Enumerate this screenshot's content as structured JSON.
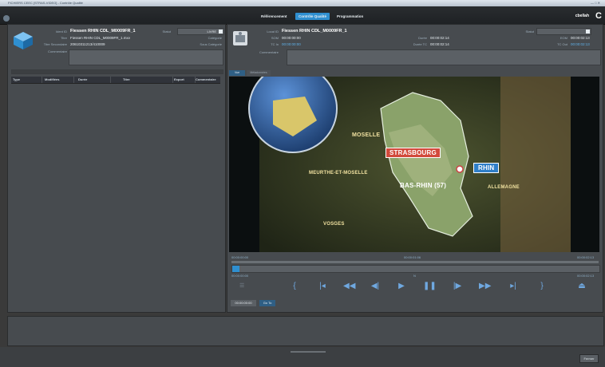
{
  "window": {
    "title": "FICHIERS CEEC [STRAS-VIDEO] - Contrôle Qualité",
    "controls": "— □ ✕"
  },
  "nav": {
    "tabs": [
      {
        "label": "Référencement",
        "active": false
      },
      {
        "label": "Contrôle Qualité",
        "active": true
      },
      {
        "label": "Programmation",
        "active": false
      }
    ],
    "user": "cbellah",
    "user_glyph": "C"
  },
  "left_panel": {
    "title_label": "Ident ID",
    "title_value": "Fiessen RHIN CDL_M0009FR_1",
    "status_label": "Statut",
    "status_value": "LIVRE",
    "fichier_label": "Titre",
    "fichier_value": "Fiessen RHIN CDL_M0009FR_1.mxv",
    "categorie_label": "Catégorie",
    "titre_sec_label": "Titre Secondaire",
    "titre_sec_value": "20610311213/410009",
    "sous_categorie_label": "Sous Catégorie",
    "commentaire_label": "Commentaire",
    "grid_headers": [
      "Type",
      "Modifiées",
      "Durée",
      "Titre",
      "Export",
      "Commentaire"
    ]
  },
  "right_panel": {
    "local_id_label": "Local ID",
    "local_id_value": "Fiessen RHIN CDL_M0009FR_1",
    "som_label": "SOM",
    "som_value": "00:00:00:00",
    "tc_in_label": "TC In",
    "tc_in_value": "00:00:00:00",
    "duree_label": "Durée",
    "duree_value": "00:00:02:14",
    "duree_tc_label": "Durée TC",
    "duree_tc_value": "00:00:02:14",
    "statut_label": "Statut",
    "eom_label": "EOM",
    "eom_value": "00:00:02:13",
    "tc_out_label": "TC Out",
    "tc_out_value": "00:00:02:13",
    "commentaire_label": "Commentaire",
    "tabs": [
      "Vue",
      "Métadonnées"
    ]
  },
  "video": {
    "labels": {
      "moselle": "MOSELLE",
      "strasbourg": "STRASBOURG",
      "rhin": "RHIN",
      "meurthe": "MEURTHE-ET-MOSELLE",
      "basrhin": "BAS-RHIN (57)",
      "allemagne": "ALLEMAGNE",
      "vosges": "VOSGES"
    }
  },
  "timeline": {
    "start": "00:00:00:00",
    "middle": "00:00:01:06",
    "end": "00:00:02:13",
    "cur_left": "00:00:00:00",
    "cur_right": "00:00:02:13",
    "marker": "N",
    "progress": 0.02,
    "current_time": "00:00:00:00",
    "goto_label": "Go To"
  },
  "controls": [
    {
      "name": "mark-in-icon",
      "glyph": "{"
    },
    {
      "name": "goto-in-icon",
      "glyph": "|◂"
    },
    {
      "name": "rewind-icon",
      "glyph": "◀◀"
    },
    {
      "name": "step-back-icon",
      "glyph": "◀|"
    },
    {
      "name": "play-icon",
      "glyph": "▶"
    },
    {
      "name": "pause-icon",
      "glyph": "❚❚"
    },
    {
      "name": "step-forward-icon",
      "glyph": "|▶"
    },
    {
      "name": "fast-forward-icon",
      "glyph": "▶▶"
    },
    {
      "name": "goto-out-icon",
      "glyph": "▸|"
    },
    {
      "name": "mark-out-icon",
      "glyph": "}"
    },
    {
      "name": "eject-icon",
      "glyph": "⏏"
    }
  ],
  "footer": {
    "close_label": "Fermer"
  }
}
